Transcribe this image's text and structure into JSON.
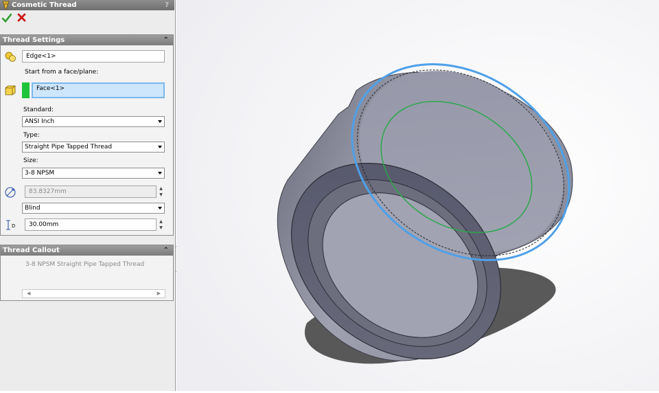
{
  "panel": {
    "title": "Cosmetic Thread",
    "help": "?"
  },
  "thread_settings": {
    "header": "Thread Settings",
    "edge": "Edge<1>",
    "start_label": "Start from a face/plane:",
    "face": "Face<1>",
    "standard_label": "Standard:",
    "standard": "ANSI Inch",
    "type_label": "Type:",
    "type": "Straight Pipe Tapped Thread",
    "size_label": "Size:",
    "size": "3-8 NPSM",
    "diameter": "83.8327mm",
    "end_condition": "Blind",
    "depth": "30.00mm",
    "depth_symbol": "D"
  },
  "thread_callout": {
    "header": "Thread Callout",
    "text": "3-8 NPSM Straight Pipe Tapped Thread"
  },
  "colors": {
    "accent_select": "#79b7ec",
    "accept": "#2e9e2e",
    "cancel": "#cc1a1a",
    "face_swatch": "#1fc43a",
    "part_body": "#8d8fa0",
    "thread_edge": "#4fa0e8",
    "thread_circle": "#2aa84a"
  }
}
